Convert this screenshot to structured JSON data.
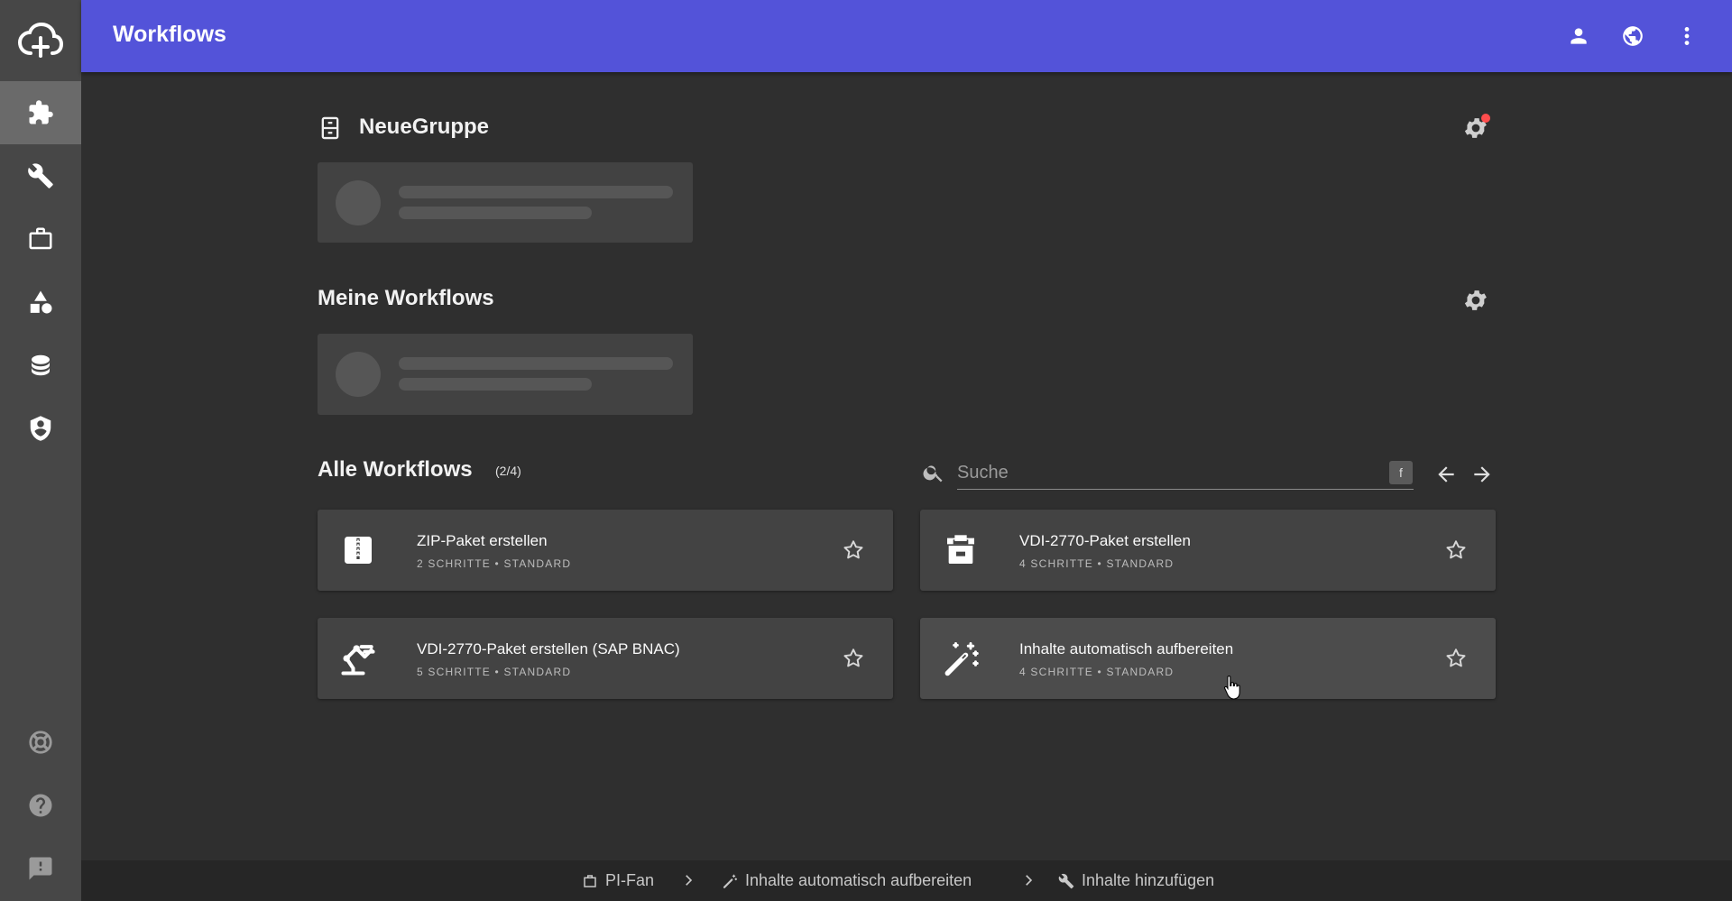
{
  "header": {
    "title": "Workflows",
    "icons": [
      "account-icon",
      "globe-icon",
      "more-vert-icon"
    ]
  },
  "sidebar": {
    "logo": "cloud-upload-icon",
    "items": [
      {
        "icon": "puzzle-icon",
        "active": true
      },
      {
        "icon": "wrench-icon",
        "active": false
      },
      {
        "icon": "briefcase-icon",
        "active": false
      },
      {
        "icon": "shapes-icon",
        "active": false
      },
      {
        "icon": "database-icon",
        "active": false
      },
      {
        "icon": "shield-account-icon",
        "active": false
      }
    ],
    "bottom_items": [
      {
        "icon": "lifebuoy-icon"
      },
      {
        "icon": "help-circle-icon"
      },
      {
        "icon": "feedback-icon"
      }
    ]
  },
  "groups": [
    {
      "title": "NeueGruppe",
      "icon": "cabinet-icon",
      "settings_badge": true
    },
    {
      "title": "Meine Workflows",
      "settings_badge": false
    }
  ],
  "all_workflows": {
    "title": "Alle Workflows",
    "count": "(2/4)",
    "search": {
      "placeholder": "Suche",
      "shortcut": "f"
    },
    "cards": [
      {
        "title": "ZIP-Paket erstellen",
        "subtitle": "2 SCHRITTE • STANDARD",
        "icon": "zip-box-icon"
      },
      {
        "title": "VDI-2770-Paket erstellen",
        "subtitle": "4 SCHRITTE • STANDARD",
        "icon": "package-icon"
      },
      {
        "title": "VDI-2770-Paket erstellen (SAP BNAC)",
        "subtitle": "5 SCHRITTE • STANDARD",
        "icon": "robot-arm-icon"
      },
      {
        "title": "Inhalte automatisch aufbereiten",
        "subtitle": "4 SCHRITTE • STANDARD",
        "icon": "magic-wand-icon"
      }
    ]
  },
  "footer": {
    "breadcrumbs": [
      {
        "label": "PI-Fan",
        "icon": "briefcase-icon"
      },
      {
        "label": "Inhalte automatisch aufbereiten",
        "icon": "magic-wand-icon"
      },
      {
        "label": "Inhalte hinzufügen",
        "icon": "wrench-icon"
      }
    ]
  },
  "colors": {
    "header": "#5353d9",
    "sidebar": "#474747",
    "background": "#2f2f2f",
    "card": "#434343",
    "badge": "#ff4d4d"
  }
}
